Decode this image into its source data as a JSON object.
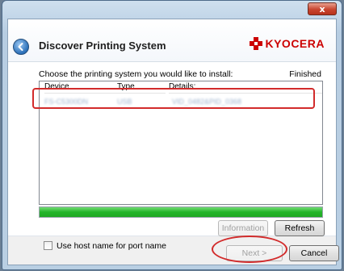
{
  "window": {
    "close_symbol": "x"
  },
  "header": {
    "title": "Discover Printing System",
    "brand": "KYOCERA",
    "back_icon": "back-arrow-icon"
  },
  "main": {
    "instruction": "Choose the printing system you would like to install:",
    "status": "Finished",
    "columns": [
      "Device",
      "Type",
      "Details:"
    ],
    "rows": [
      {
        "device": "FS-C5300DN",
        "type": "USB",
        "details": "VID_0482&PID_0368"
      }
    ],
    "progress_percent": 100,
    "progress_color": "#24b52a"
  },
  "options": {
    "use_host_name_label": "Use host name for port name",
    "use_host_name_checked": false
  },
  "buttons": {
    "information": "Information",
    "refresh": "Refresh",
    "next": "Next >",
    "cancel": "Cancel"
  },
  "colors": {
    "brand_red": "#cc0000",
    "annotation_red": "#d22b2b"
  }
}
